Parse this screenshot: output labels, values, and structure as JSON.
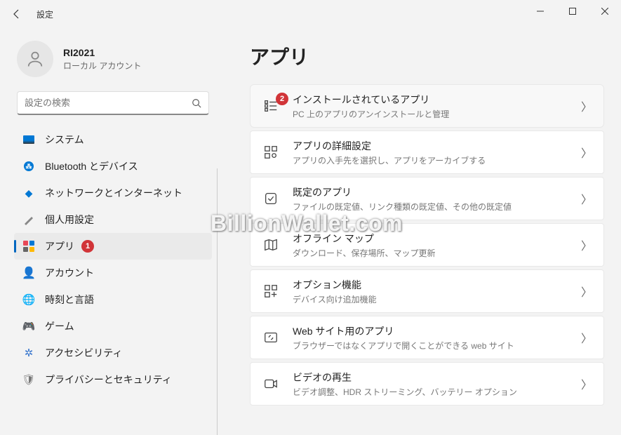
{
  "window": {
    "title": "設定"
  },
  "user": {
    "name": "RI2021",
    "sub": "ローカル アカウント"
  },
  "search": {
    "placeholder": "設定の検索"
  },
  "nav": [
    {
      "key": "system",
      "label": "システム"
    },
    {
      "key": "bluetooth",
      "label": "Bluetooth とデバイス"
    },
    {
      "key": "network",
      "label": "ネットワークとインターネット"
    },
    {
      "key": "personalization",
      "label": "個人用設定"
    },
    {
      "key": "apps",
      "label": "アプリ",
      "badge": "1"
    },
    {
      "key": "accounts",
      "label": "アカウント"
    },
    {
      "key": "time",
      "label": "時刻と言語"
    },
    {
      "key": "gaming",
      "label": "ゲーム"
    },
    {
      "key": "accessibility",
      "label": "アクセシビリティ"
    },
    {
      "key": "privacy",
      "label": "プライバシーとセキュリティ"
    }
  ],
  "page": {
    "title": "アプリ"
  },
  "cards": [
    {
      "title": "インストールされているアプリ",
      "sub": "PC 上のアプリのアンインストールと管理",
      "badge": "2"
    },
    {
      "title": "アプリの詳細設定",
      "sub": "アプリの入手先を選択し、アプリをアーカイブする"
    },
    {
      "title": "既定のアプリ",
      "sub": "ファイルの既定値、リンク種類の既定値、その他の既定値"
    },
    {
      "title": "オフライン マップ",
      "sub": "ダウンロード、保存場所、マップ更新"
    },
    {
      "title": "オプション機能",
      "sub": "デバイス向け追加機能"
    },
    {
      "title": "Web サイト用のアプリ",
      "sub": "ブラウザーではなくアプリで開くことができる web サイト"
    },
    {
      "title": "ビデオの再生",
      "sub": "ビデオ調整、HDR ストリーミング、バッテリー オプション"
    }
  ],
  "watermark": "BillionWallet.com"
}
